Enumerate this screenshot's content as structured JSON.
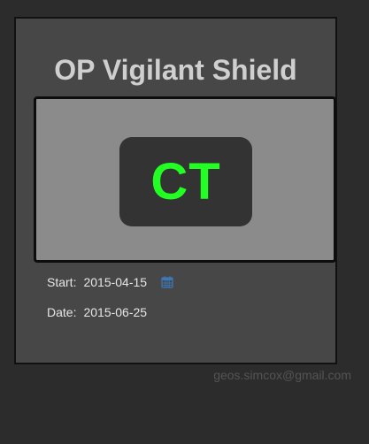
{
  "card": {
    "title": "OP Vigilant Shield",
    "badge": {
      "text": "CT",
      "text_color": "#22ff22"
    },
    "start": {
      "label": "Start:",
      "value": "2015-04-15",
      "icon": "calendar-icon",
      "icon_color": "#3b78b8"
    },
    "date": {
      "label": "Date:",
      "value": "2015-06-25"
    }
  },
  "footer": {
    "email": "geos.simcox@gmail.com"
  }
}
